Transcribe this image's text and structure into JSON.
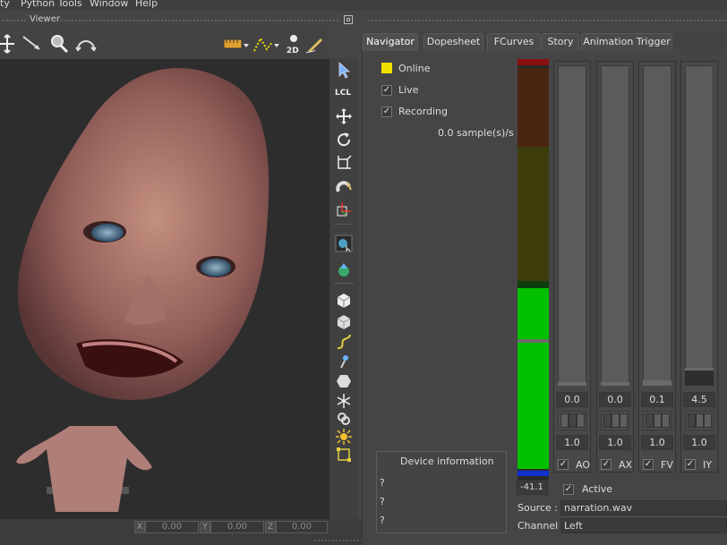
{
  "menu": {
    "items": [
      "ty",
      "Python Tools",
      "Window",
      "Help"
    ]
  },
  "viewer": {
    "title": "Viewer"
  },
  "coords": {
    "x_label": "X",
    "x_value": "0.00",
    "y_label": "Y",
    "y_value": "0.00",
    "z_label": "Z",
    "z_value": "0.00"
  },
  "tabs": [
    "Navigator",
    "Dopesheet",
    "FCurves",
    "Story",
    "Animation Trigger"
  ],
  "navigator": {
    "online_label": "Online",
    "live_label": "Live",
    "recording_label": "Recording",
    "rate": "0.0 sample(s)/s",
    "device_info_title": "Device information",
    "device_info_lines": [
      "?",
      "?",
      "?"
    ],
    "meter_value": "-41.1",
    "active_label": "Active",
    "source_label": "Source :",
    "source_value": "narration.wav",
    "channel_label": "Channel :",
    "channel_value": "Left"
  },
  "sliders": [
    {
      "name": "AO",
      "value": "0.0",
      "scale": "1.0",
      "checked": true
    },
    {
      "name": "AX",
      "value": "0.0",
      "scale": "1.0",
      "checked": true
    },
    {
      "name": "FV",
      "value": "0.1",
      "scale": "1.0",
      "checked": true
    },
    {
      "name": "IY",
      "value": "4.5",
      "scale": "1.0",
      "checked": true
    }
  ],
  "colors": {
    "online_indicator": "#f0e000",
    "meter_green": "#00c000",
    "meter_olive": "#3e3e0c",
    "meter_brown": "#4a2612",
    "meter_red": "#8a1010",
    "meter_blue": "#1030d0"
  }
}
